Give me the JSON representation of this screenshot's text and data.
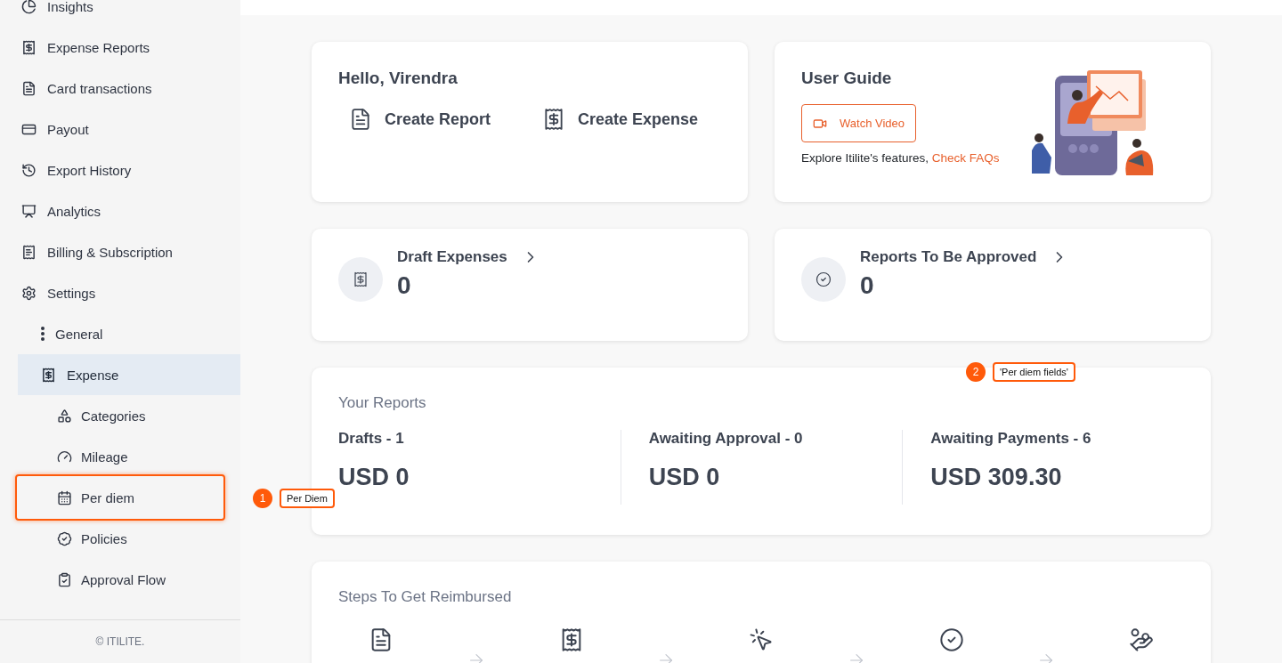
{
  "sidebar": {
    "items": [
      {
        "label": "Insights",
        "selected": false
      },
      {
        "label": "Expense Reports",
        "selected": false
      },
      {
        "label": "Card transactions",
        "selected": false
      },
      {
        "label": "Payout",
        "selected": false
      },
      {
        "label": "Export History",
        "selected": false
      },
      {
        "label": "Analytics",
        "selected": false
      },
      {
        "label": "Billing & Subscription",
        "selected": false
      },
      {
        "label": "Settings",
        "selected": false,
        "children": [
          {
            "label": "General",
            "selected": false
          },
          {
            "label": "Expense",
            "selected": true,
            "children": [
              {
                "label": "Categories",
                "selected": false
              },
              {
                "label": "Mileage",
                "selected": false
              },
              {
                "label": "Per diem",
                "selected": false,
                "highlighted": true
              },
              {
                "label": "Policies",
                "selected": false
              },
              {
                "label": "Approval Flow",
                "selected": false
              }
            ]
          }
        ]
      }
    ],
    "footer": "© ITILITE."
  },
  "greeting": {
    "title": "Hello, Virendra",
    "actions": [
      {
        "label": "Create Report"
      },
      {
        "label": "Create Expense"
      }
    ]
  },
  "user_guide": {
    "title": "User Guide",
    "button": "Watch Video",
    "text": "Explore Itilite's features, ",
    "link": "Check FAQs"
  },
  "stats": [
    {
      "title": "Draft Expenses",
      "value": "0"
    },
    {
      "title": "Reports To Be Approved",
      "value": "0"
    }
  ],
  "your_reports": {
    "title": "Your Reports",
    "columns": [
      {
        "label": "Drafts - 1",
        "amount": "USD 0"
      },
      {
        "label": "Awaiting Approval - 0",
        "amount": "USD 0"
      },
      {
        "label": "Awaiting Payments - 6",
        "amount": "USD 309.30"
      }
    ]
  },
  "steps": {
    "title": "Steps To Get Reimbursed"
  },
  "annotations": [
    {
      "number": "1",
      "label": "Per Diem"
    },
    {
      "number": "2",
      "label": "'Per diem fields'"
    }
  ]
}
